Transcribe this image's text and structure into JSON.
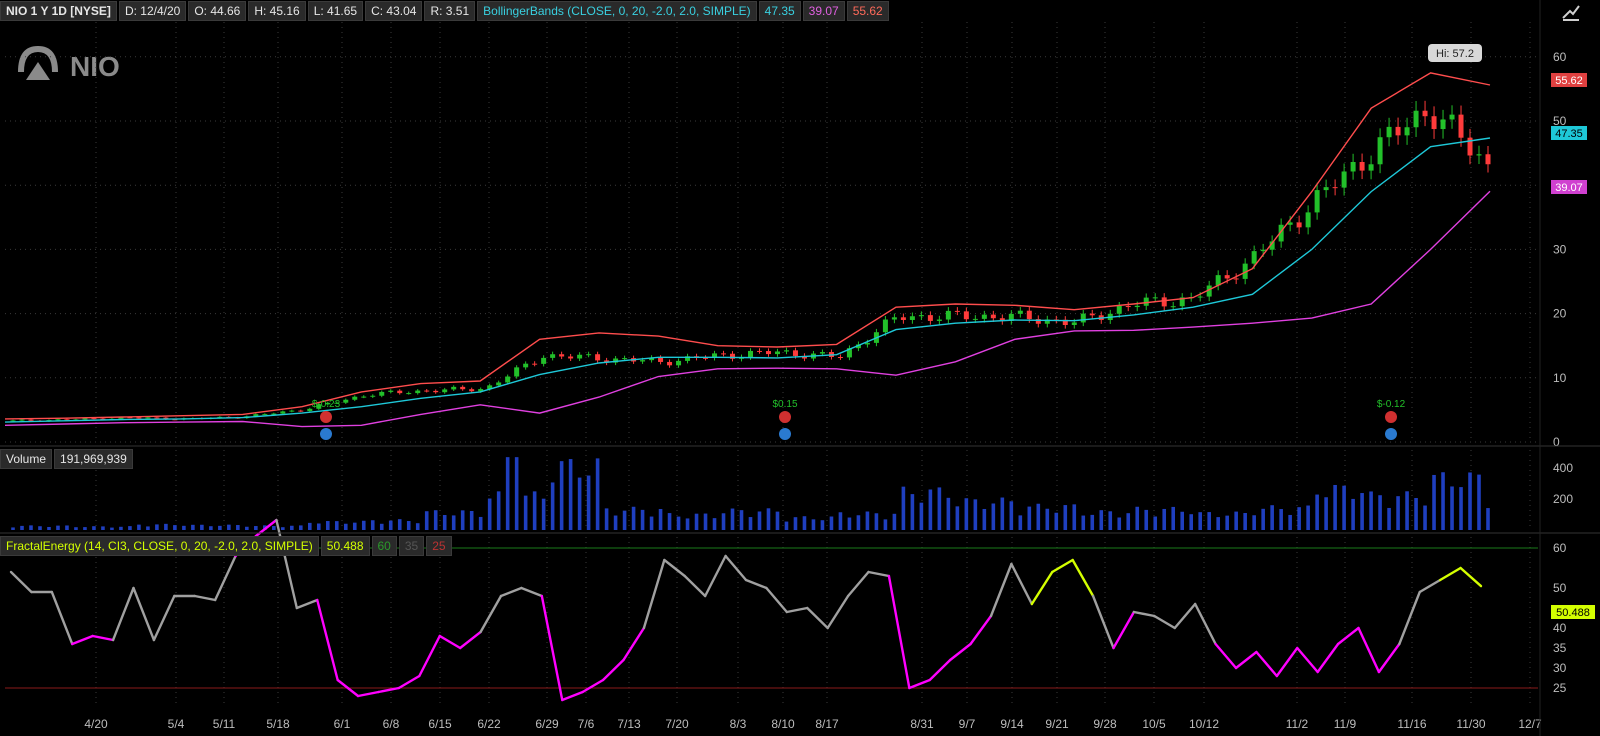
{
  "header": {
    "symbol": "NIO 1 Y 1D [NYSE]",
    "date": "D: 12/4/20",
    "open": "O: 44.66",
    "high": "H: 45.16",
    "low": "L: 41.65",
    "close": "C: 43.04",
    "range": "R: 3.51",
    "study": "BollingerBands (CLOSE, 0, 20, -2.0, 2.0, SIMPLE)",
    "mid_val": "47.35",
    "lower_val": "39.07",
    "upper_val": "55.62"
  },
  "logo_text": "NIO",
  "price_axis": {
    "ticks": [
      "60",
      "50",
      "40",
      "30",
      "20",
      "10",
      "0"
    ],
    "badges": {
      "upper": "55.62",
      "mid": "47.35",
      "lower": "39.07"
    },
    "hi_label": "Hi: 57.2"
  },
  "earnings": [
    {
      "label": "$-0.23"
    },
    {
      "label": "$0.15"
    },
    {
      "label": "$-0.12"
    }
  ],
  "volume_panel": {
    "label": "Volume",
    "value": "191,969,939",
    "ticks": [
      "400",
      "200"
    ]
  },
  "fe_panel": {
    "label": "FractalEnergy (14, CI3, CLOSE, 0, 20, -2.0, 2.0, SIMPLE)",
    "value": "50.488",
    "lvl_hi": "60",
    "lvl_mid": "35",
    "lvl_lo": "25",
    "ticks": [
      "60",
      "50",
      "40",
      "35",
      "30",
      "25"
    ],
    "current": "50.488"
  },
  "x_axis": {
    "labels": [
      "4/20",
      "5/4",
      "5/11",
      "5/18",
      "6/1",
      "6/8",
      "6/15",
      "6/22",
      "6/29",
      "7/6",
      "7/13",
      "7/20",
      "8/3",
      "8/10",
      "8/17",
      "8/31",
      "9/7",
      "9/14",
      "9/21",
      "9/28",
      "10/5",
      "10/12",
      "11/2",
      "11/9",
      "11/16",
      "11/30",
      "12/7"
    ]
  },
  "colors": {
    "up": "#22c02a",
    "down": "#ff3b3b",
    "upper_band": "#ff4d4d",
    "mid_band": "#1ec8d8",
    "lower_band": "#e040e0",
    "volume": "#1f3fbf",
    "fe_gray": "#a0a0a0",
    "fe_magenta": "#ff00ff",
    "fe_yellow": "#d4ff00"
  },
  "chart_data": [
    {
      "type": "candlestick",
      "title": "NIO 1 Y 1D [NYSE]",
      "x_labels": [
        "4/20",
        "5/4",
        "5/11",
        "5/18",
        "6/1",
        "6/8",
        "6/15",
        "6/22",
        "6/29",
        "7/6",
        "7/13",
        "7/20",
        "8/3",
        "8/10",
        "8/17",
        "8/31",
        "9/7",
        "9/14",
        "9/21",
        "9/28",
        "10/5",
        "10/12",
        "11/2",
        "11/9",
        "11/16",
        "11/30",
        "12/7"
      ],
      "ylim": [
        0,
        60
      ],
      "series": [
        {
          "name": "Upper",
          "values": [
            3.6,
            3.7,
            3.9,
            4.1,
            4.3,
            5.5,
            7.8,
            9.1,
            9.5,
            16,
            17,
            16.5,
            15,
            14.8,
            15.2,
            21,
            21.5,
            21.3,
            20.6,
            21.5,
            22.5,
            27,
            39,
            52,
            57.5,
            55.6
          ]
        },
        {
          "name": "Middle",
          "values": [
            3.1,
            3.3,
            3.5,
            3.6,
            3.8,
            4.5,
            5.5,
            6.8,
            7.8,
            10.5,
            12.3,
            13.2,
            13.2,
            13.1,
            13.6,
            17.5,
            18.5,
            19,
            18.9,
            19.8,
            21,
            23,
            30,
            39,
            46,
            47.35
          ]
        },
        {
          "name": "Lower",
          "values": [
            2.6,
            2.8,
            3.0,
            3.1,
            3.2,
            2.4,
            2.6,
            4.3,
            5.8,
            4.5,
            7.0,
            10.2,
            11.4,
            11.5,
            11.4,
            10.4,
            12.5,
            16,
            17.3,
            17.4,
            17.9,
            18.5,
            19.3,
            21.5,
            30,
            39.07
          ]
        },
        {
          "name": "Close",
          "values": [
            3.3,
            3.5,
            3.8,
            3.6,
            4.0,
            5.2,
            7.4,
            8.0,
            8.3,
            13.5,
            13,
            12.5,
            13.5,
            14,
            13.2,
            19.5,
            19.6,
            19.5,
            18.6,
            21.5,
            22.3,
            28.5,
            37,
            45,
            52,
            43.04
          ]
        }
      ]
    },
    {
      "type": "bar",
      "title": "Volume",
      "ylim": [
        0,
        480
      ],
      "values": [
        30,
        25,
        40,
        35,
        30,
        60,
        70,
        130,
        250,
        470,
        150,
        110,
        140,
        90,
        120,
        280,
        210,
        170,
        130,
        150,
        120,
        160,
        300,
        250,
        380,
        220
      ]
    },
    {
      "type": "line",
      "title": "FractalEnergy (14, CI3, CLOSE, 0, 20, -2.0, 2.0, SIMPLE)",
      "ylim": [
        22,
        65
      ],
      "values": [
        54,
        49,
        49,
        36,
        38,
        37,
        50,
        37,
        48,
        48,
        47,
        58,
        63,
        67,
        45,
        47,
        27,
        23,
        24,
        25,
        28,
        38,
        35,
        39,
        48,
        50,
        48,
        22,
        24,
        27,
        32,
        40,
        57,
        53,
        48,
        58,
        52,
        50,
        44,
        45,
        40,
        48,
        54,
        53,
        25,
        27,
        32,
        36,
        43,
        56,
        46,
        54,
        57,
        48,
        35,
        44,
        43,
        40,
        46,
        36,
        30,
        34,
        28,
        35,
        29,
        36,
        40,
        29,
        36,
        49,
        52,
        55,
        50.488
      ]
    }
  ]
}
